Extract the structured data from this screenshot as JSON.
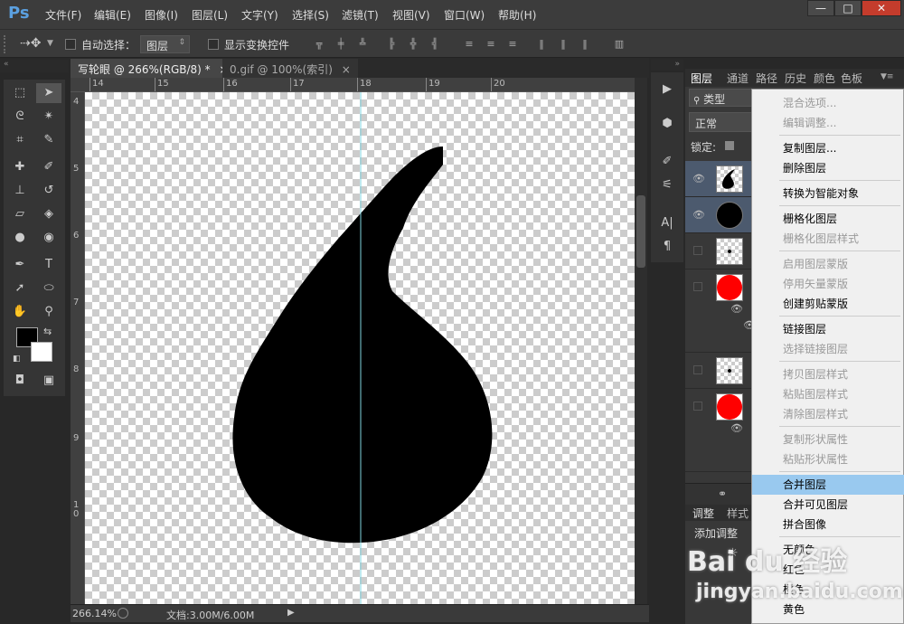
{
  "app": {
    "logo": "Ps"
  },
  "menu": [
    "文件(F)",
    "编辑(E)",
    "图像(I)",
    "图层(L)",
    "文字(Y)",
    "选择(S)",
    "滤镜(T)",
    "视图(V)",
    "窗口(W)",
    "帮助(H)"
  ],
  "window_controls": {
    "minimize": "—",
    "maximize": "□",
    "close": "✕"
  },
  "options": {
    "auto_select_label": "自动选择：",
    "auto_select_value": "图层",
    "show_transform_label": "显示变换控件"
  },
  "doc_tabs": [
    {
      "label": "写轮眼 @ 266%(RGB/8) *",
      "close": "×",
      "active": true
    },
    {
      "label": "0.gif @ 100%(索引)",
      "close": "×",
      "active": false
    }
  ],
  "ruler_top": [
    "14",
    "15",
    "16",
    "17",
    "18",
    "19",
    "20"
  ],
  "ruler_left": [
    "4",
    "5",
    "6",
    "7",
    "8",
    "9",
    "1\n0"
  ],
  "status": {
    "zoom": "266.14%",
    "doc": "文档:3.00M/6.00M"
  },
  "panel_tabs": [
    "图层",
    "通道",
    "路径",
    "历史",
    "颜色",
    "色板"
  ],
  "layers_panel": {
    "kind_label": "类型",
    "blend_mode": "正常",
    "lock_label": "锁定:"
  },
  "adjust_tabs": [
    "调整",
    "样式"
  ],
  "adjust_label": "添加调整",
  "context_menu": [
    {
      "label": "混合选项...",
      "disabled": true
    },
    {
      "label": "编辑调整...",
      "disabled": true
    },
    {
      "sep": true
    },
    {
      "label": "复制图层...",
      "disabled": false
    },
    {
      "label": "删除图层",
      "disabled": false
    },
    {
      "sep": true
    },
    {
      "label": "转换为智能对象",
      "disabled": false
    },
    {
      "sep": true
    },
    {
      "label": "栅格化图层",
      "disabled": false
    },
    {
      "label": "栅格化图层样式",
      "disabled": true
    },
    {
      "sep": true
    },
    {
      "label": "启用图层蒙版",
      "disabled": true
    },
    {
      "label": "停用矢量蒙版",
      "disabled": true
    },
    {
      "label": "创建剪贴蒙版",
      "disabled": false
    },
    {
      "sep": true
    },
    {
      "label": "链接图层",
      "disabled": false
    },
    {
      "label": "选择链接图层",
      "disabled": true
    },
    {
      "sep": true
    },
    {
      "label": "拷贝图层样式",
      "disabled": true
    },
    {
      "label": "粘贴图层样式",
      "disabled": true
    },
    {
      "label": "清除图层样式",
      "disabled": true
    },
    {
      "sep": true
    },
    {
      "label": "复制形状属性",
      "disabled": true
    },
    {
      "label": "粘贴形状属性",
      "disabled": true
    },
    {
      "sep": true
    },
    {
      "label": "合并图层",
      "disabled": false,
      "highlight": true
    },
    {
      "label": "合并可见图层",
      "disabled": false
    },
    {
      "label": "拼合图像",
      "disabled": false
    },
    {
      "sep": true
    },
    {
      "label": "无颜色",
      "disabled": false
    },
    {
      "label": "红色",
      "disabled": false
    },
    {
      "label": "橙色",
      "disabled": false
    },
    {
      "label": "黄色",
      "disabled": false
    }
  ],
  "watermark": {
    "line1": "Bai du 经验",
    "line2": "jingyan.baidu.com"
  },
  "colors": {
    "accent": "#99c9ef",
    "ui_bg": "#282828",
    "red_layer": "#ff0000"
  }
}
